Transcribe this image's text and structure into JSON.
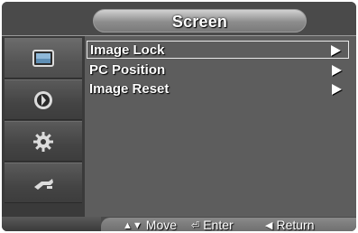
{
  "screen": {
    "title": "Screen"
  },
  "sidebar": {
    "items": [
      {
        "icon": "picture-icon",
        "active": true
      },
      {
        "icon": "sound-icon",
        "active": false
      },
      {
        "icon": "setup-gear-icon",
        "active": false
      },
      {
        "icon": "input-plug-icon",
        "active": false
      }
    ]
  },
  "menu": {
    "items": [
      {
        "label": "Image Lock",
        "selected": true
      },
      {
        "label": "PC Position",
        "selected": false
      },
      {
        "label": "Image Reset",
        "selected": false
      }
    ]
  },
  "footer": {
    "move_label": "Move",
    "enter_label": "Enter",
    "return_label": "Return"
  },
  "colors": {
    "background": "#5b5b5b",
    "sidebar": "#3a3a3a",
    "text": "#ffffff"
  }
}
